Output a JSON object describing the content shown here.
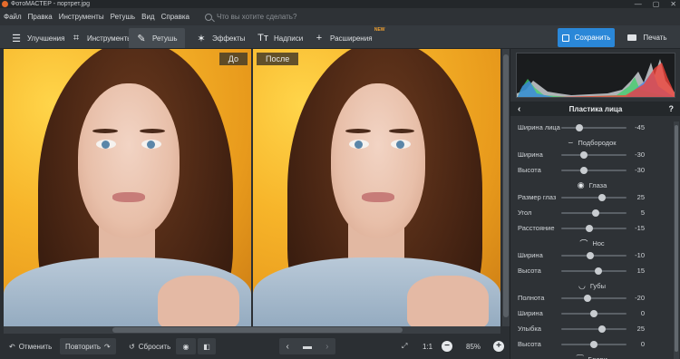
{
  "window": {
    "title": "ФотоМАСТЕР - портрет.jpg",
    "controls": [
      "—",
      "▢",
      "✕"
    ]
  },
  "menu": {
    "items": [
      "Файл",
      "Правка",
      "Инструменты",
      "Ретушь",
      "Вид",
      "Справка"
    ],
    "search_placeholder": "Что вы хотите сделать?"
  },
  "toolbar": {
    "tabs": [
      {
        "label": "Улучшения",
        "icon": "sliders-icon",
        "glyph": "☰"
      },
      {
        "label": "Инструменты",
        "icon": "crop-icon",
        "glyph": "⌗"
      },
      {
        "label": "Ретушь",
        "icon": "brush-icon",
        "glyph": "✎"
      },
      {
        "label": "Эффекты",
        "icon": "magic-wand-icon",
        "glyph": "✶"
      },
      {
        "label": "Надписи",
        "icon": "text-icon",
        "glyph": "Tт"
      },
      {
        "label": "Расширения",
        "icon": "plus-icon",
        "glyph": "+"
      }
    ],
    "active_tab": "Ретушь",
    "new_badge": "NEW",
    "save_label": "Сохранить",
    "print_label": "Печать"
  },
  "photo": {
    "before_label": "До",
    "after_label": "После"
  },
  "bottom": {
    "undo_label": "Отменить",
    "redo_label": "Повторить",
    "reset_label": "Сбросить",
    "zoom_1to1": "1:1",
    "zoom_level": "85%"
  },
  "panel": {
    "title": "Пластика лица",
    "help": "?",
    "rows": [
      {
        "label": "Ширина лица",
        "value": "-45"
      },
      {
        "label": "Подбородок",
        "section": true,
        "icon": "chin-icon",
        "glyph": "⌣"
      },
      {
        "label": "Ширина",
        "value": "-30"
      },
      {
        "label": "Высота",
        "value": "-30"
      },
      {
        "label": "Глаза",
        "section": true,
        "icon": "eye-icon",
        "glyph": "◉"
      },
      {
        "label": "Размер глаз",
        "value": "25"
      },
      {
        "label": "Угол",
        "value": "5"
      },
      {
        "label": "Расстояние",
        "value": "-15"
      },
      {
        "label": "Нос",
        "section": true,
        "icon": "nose-icon",
        "glyph": "⌒"
      },
      {
        "label": "Ширина",
        "value": "-10"
      },
      {
        "label": "Высота",
        "value": "15"
      },
      {
        "label": "Губы",
        "section": true,
        "icon": "lips-icon",
        "glyph": "◡"
      },
      {
        "label": "Полнота",
        "value": "-20"
      },
      {
        "label": "Ширина",
        "value": "0"
      },
      {
        "label": "Улыбка",
        "value": "25"
      },
      {
        "label": "Высота",
        "value": "0"
      },
      {
        "label": "Брови",
        "section": true,
        "icon": "brows-icon",
        "glyph": "⁀"
      }
    ]
  },
  "colors": {
    "accent": "#2a87d8",
    "new_badge": "#f0a030",
    "background": "#2b2f33"
  }
}
